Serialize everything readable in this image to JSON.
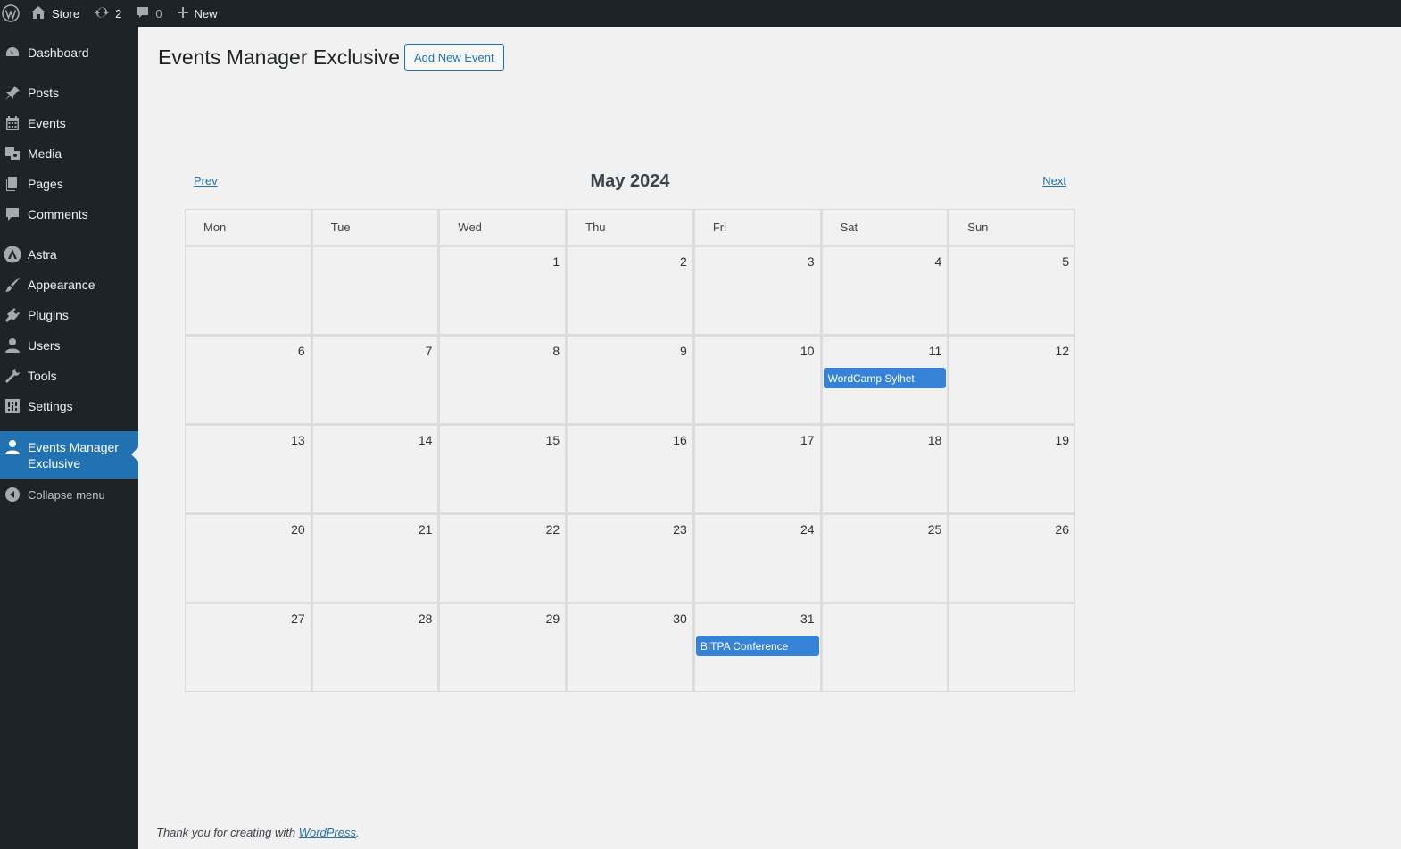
{
  "adminbar": {
    "site_name": "Store",
    "updates_count": "2",
    "comments_count": "0",
    "new_label": "New"
  },
  "sidebar": {
    "items": [
      {
        "label": "Dashboard",
        "icon": "dashboard-icon"
      },
      {
        "label": "Posts",
        "icon": "pin-icon"
      },
      {
        "label": "Events",
        "icon": "calendar-icon"
      },
      {
        "label": "Media",
        "icon": "media-icon"
      },
      {
        "label": "Pages",
        "icon": "pages-icon"
      },
      {
        "label": "Comments",
        "icon": "comment-icon"
      },
      {
        "label": "Astra",
        "icon": "astra-icon"
      },
      {
        "label": "Appearance",
        "icon": "brush-icon"
      },
      {
        "label": "Plugins",
        "icon": "plug-icon"
      },
      {
        "label": "Users",
        "icon": "user-icon"
      },
      {
        "label": "Tools",
        "icon": "wrench-icon"
      },
      {
        "label": "Settings",
        "icon": "settings-icon"
      }
    ],
    "current_label": "Events Manager Exclusive",
    "collapse_label": "Collapse menu"
  },
  "page": {
    "title": "Events Manager Exclusive",
    "add_new_label": "Add New Event"
  },
  "calendar": {
    "prev_label": "Prev",
    "next_label": "Next",
    "month_label": "May 2024",
    "weekdays": [
      "Mon",
      "Tue",
      "Wed",
      "Thu",
      "Fri",
      "Sat",
      "Sun"
    ],
    "weeks": [
      [
        "",
        "",
        "1",
        "2",
        "3",
        "4",
        "5"
      ],
      [
        "6",
        "7",
        "8",
        "9",
        "10",
        "11",
        "12"
      ],
      [
        "13",
        "14",
        "15",
        "16",
        "17",
        "18",
        "19"
      ],
      [
        "20",
        "21",
        "22",
        "23",
        "24",
        "25",
        "26"
      ],
      [
        "27",
        "28",
        "29",
        "30",
        "31",
        "",
        ""
      ]
    ],
    "events": [
      {
        "day": "11",
        "title": "WordCamp Sylhet"
      },
      {
        "day": "31",
        "title": "BITPA Conference"
      }
    ]
  },
  "footer": {
    "text_before": "Thank you for creating with ",
    "link_label": "WordPress",
    "text_after": "."
  },
  "colors": {
    "adminbar_bg": "#1d2327",
    "accent": "#2271b1",
    "event_bg": "#3582d8",
    "page_bg": "#f1f1f1"
  }
}
